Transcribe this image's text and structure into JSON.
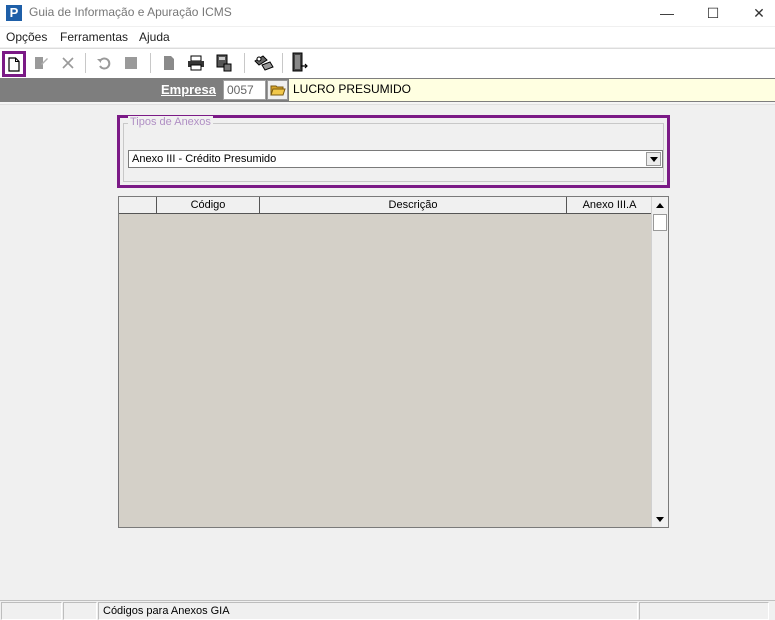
{
  "window": {
    "title": "Guia de Informação e Apuração ICMS",
    "app_icon_letter": "P",
    "minimize_glyph": "—",
    "maximize_glyph": "☐",
    "close_glyph": "✕"
  },
  "menu": {
    "items": [
      {
        "label": "Opções"
      },
      {
        "label": "Ferramentas"
      },
      {
        "label": "Ajuda"
      }
    ]
  },
  "toolbar": {
    "buttons": [
      {
        "icon": "new-document-icon",
        "enabled": true,
        "highlighted": true
      },
      {
        "icon": "edit-icon",
        "enabled": false
      },
      {
        "icon": "delete-icon",
        "enabled": false
      },
      {
        "icon": "undo-icon",
        "enabled": false
      },
      {
        "icon": "save-icon",
        "enabled": false
      },
      {
        "icon": "preview-icon",
        "enabled": false
      },
      {
        "icon": "print-icon",
        "enabled": true
      },
      {
        "icon": "print-setup-icon",
        "enabled": true
      },
      {
        "icon": "tools-icon",
        "enabled": true
      },
      {
        "icon": "exit-door-icon",
        "enabled": true
      }
    ],
    "highlight_color": "#7b1a86"
  },
  "empresa": {
    "label": "Empresa",
    "code": "0057",
    "name": "LUCRO PRESUMIDO"
  },
  "tipos_anexos": {
    "legend": "Tipos de Anexos",
    "selected": "Anexo III - Crédito Presumido"
  },
  "grid": {
    "columns": [
      {
        "label": ""
      },
      {
        "label": "Código"
      },
      {
        "label": "Descrição"
      },
      {
        "label": "Anexo III.A"
      }
    ],
    "rows": []
  },
  "statusbar": {
    "panels": [
      "",
      "",
      "Códigos para Anexos GIA",
      ""
    ]
  },
  "colors": {
    "highlight": "#7b1a86",
    "empresa_bar": "#7e7e7e",
    "empresa_name_bg": "#ffffe1",
    "grid_body": "#d4d0c8"
  }
}
